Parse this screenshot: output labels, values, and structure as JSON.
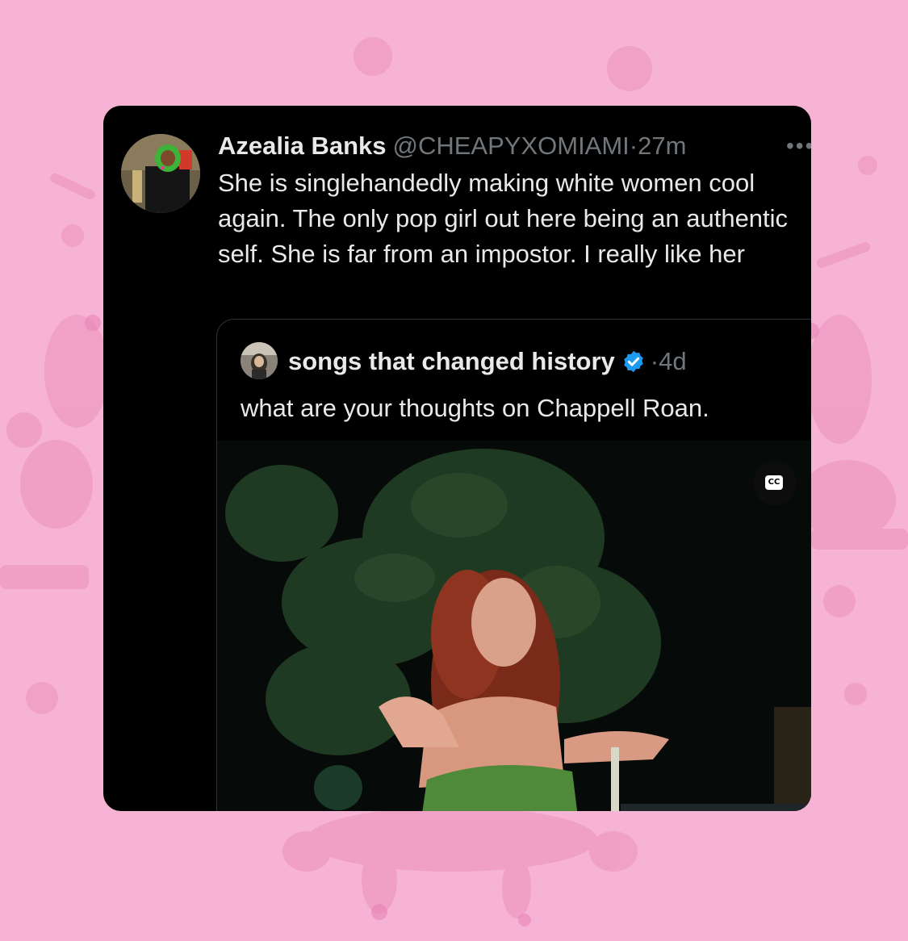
{
  "colors": {
    "background": "#f6b3d5",
    "card": "#000000",
    "text_primary": "#e7e9ea",
    "text_secondary": "#71767b",
    "verified_blue": "#1d9bf0"
  },
  "tweet": {
    "author_name": "Azealia Banks",
    "handle": "@CHEAPYXOMIAMI",
    "separator": "·",
    "time": "27m",
    "more_icon": "more-horizontal-icon",
    "text": "She is singlehandedly making white women cool again. The only pop girl out here being an authentic self. She is far from an impostor. I really like her"
  },
  "quote": {
    "author_name": "songs that changed history",
    "verified_icon": "verified-badge-icon",
    "separator": "·",
    "time": "4d",
    "text": "what are your thoughts on Chappell Roan.",
    "media": {
      "type": "video",
      "captions_button_label": "CC"
    }
  }
}
